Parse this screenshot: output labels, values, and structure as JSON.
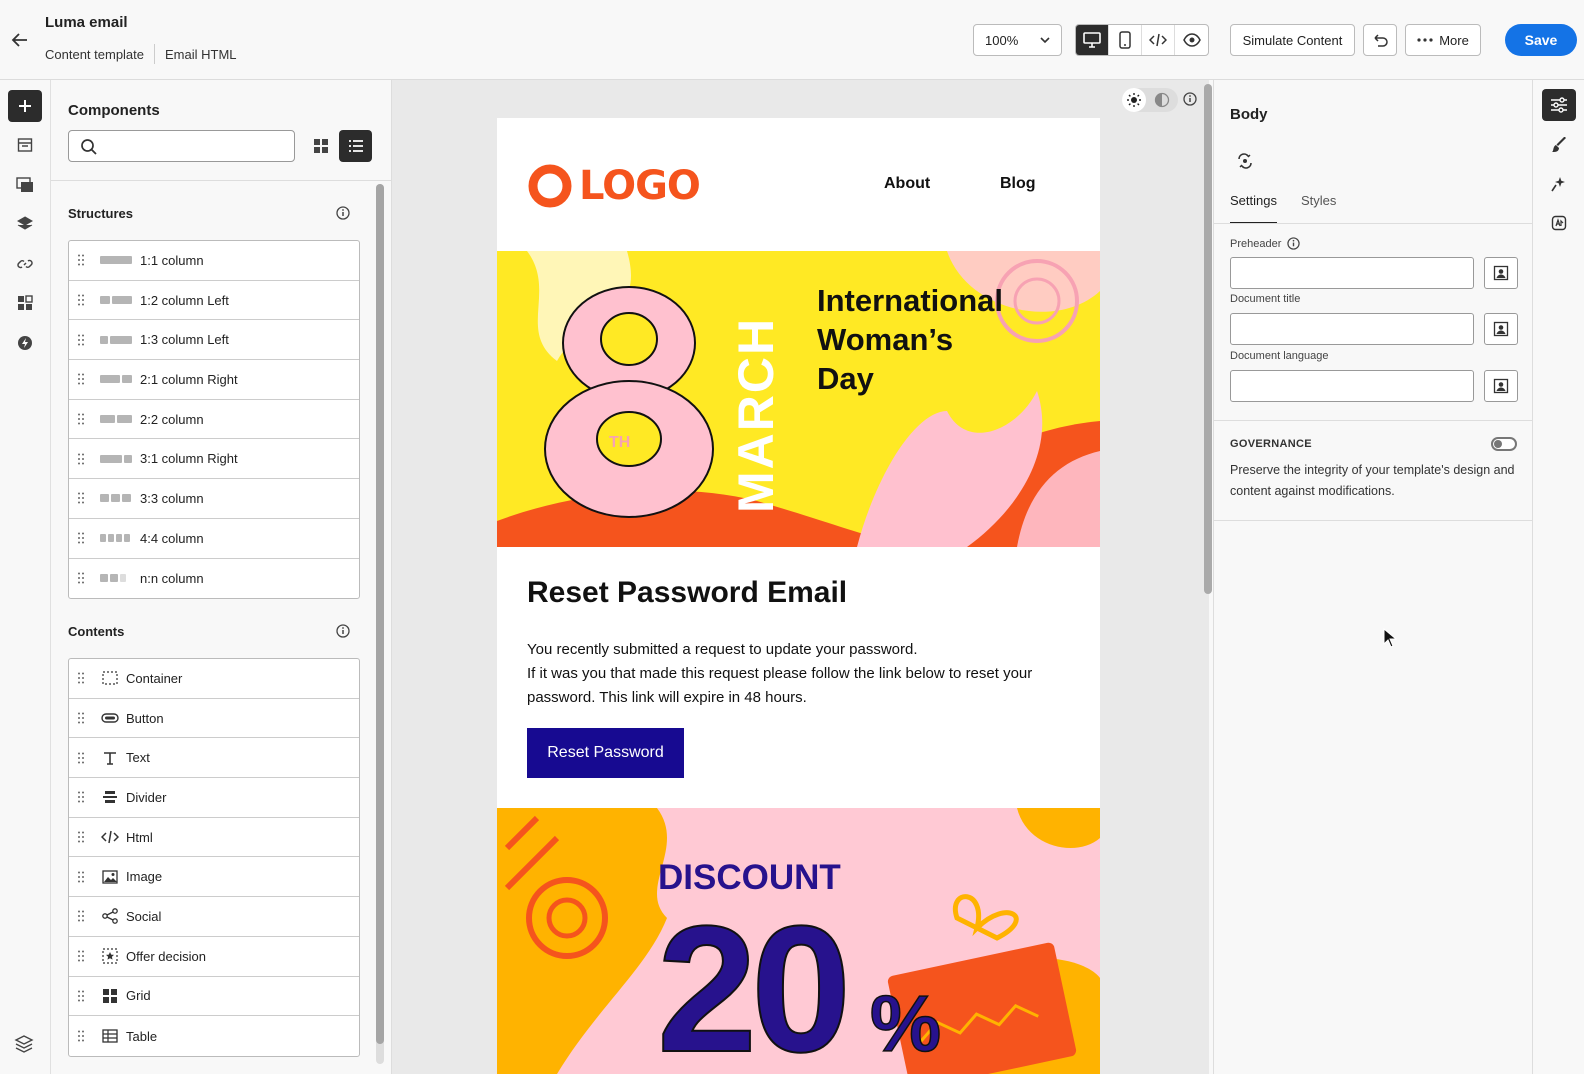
{
  "header": {
    "title": "Luma email",
    "breadcrumbs": [
      "Content template",
      "Email HTML"
    ],
    "zoom": "100%",
    "simulate_label": "Simulate Content",
    "more_label": "More",
    "save_label": "Save"
  },
  "components": {
    "title": "Components",
    "search_placeholder": "",
    "structures_label": "Structures",
    "structures": [
      {
        "label": "1:1 column"
      },
      {
        "label": "1:2 column Left"
      },
      {
        "label": "1:3 column Left"
      },
      {
        "label": "2:1 column Right"
      },
      {
        "label": "2:2 column"
      },
      {
        "label": "3:1 column Right"
      },
      {
        "label": "3:3 column"
      },
      {
        "label": "4:4 column"
      },
      {
        "label": "n:n column"
      }
    ],
    "contents_label": "Contents",
    "contents": [
      {
        "label": "Container",
        "icon": "container-icon"
      },
      {
        "label": "Button",
        "icon": "button-icon"
      },
      {
        "label": "Text",
        "icon": "text-icon"
      },
      {
        "label": "Divider",
        "icon": "divider-icon"
      },
      {
        "label": "Html",
        "icon": "code-icon"
      },
      {
        "label": "Image",
        "icon": "image-icon"
      },
      {
        "label": "Social",
        "icon": "share-icon"
      },
      {
        "label": "Offer decision",
        "icon": "offer-icon"
      },
      {
        "label": "Grid",
        "icon": "grid-icon"
      },
      {
        "label": "Table",
        "icon": "table-icon"
      }
    ]
  },
  "email": {
    "logo_text": "LOGO",
    "nav": [
      "About",
      "Blog"
    ],
    "hero_number": "8",
    "hero_suffix": "TH",
    "hero_month": "MARCH",
    "hero_title_lines": [
      "International",
      "Woman’s",
      "Day"
    ],
    "heading": "Reset Password Email",
    "text_lines": [
      "You recently submitted a request to update your password.",
      "If it was you that made this request please follow the link below to reset your password. This link will expire in 48 hours."
    ],
    "button_label": "Reset Password",
    "promo_word": "DISCOUNT",
    "promo_number": "20",
    "promo_percent": "%"
  },
  "properties": {
    "title": "Body",
    "tabs": [
      "Settings",
      "Styles"
    ],
    "fields": [
      {
        "label": "Preheader",
        "value": ""
      },
      {
        "label": "Document title",
        "value": ""
      },
      {
        "label": "Document language",
        "value": ""
      }
    ],
    "governance_title": "GOVERNANCE",
    "governance_desc": "Preserve the integrity of your template's design and content against modifications."
  },
  "colors": {
    "accent": "#1473e6",
    "logo": "#f5541d",
    "hero_bg": "#ffe924",
    "button": "#170a91",
    "promo_bg": "#ffc9d4"
  }
}
